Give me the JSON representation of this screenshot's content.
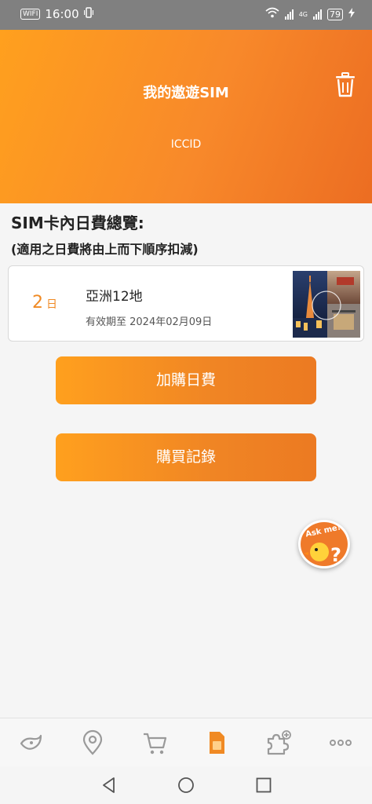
{
  "status_bar": {
    "time": "16:00",
    "left_badge": "WIFI",
    "battery": "79",
    "network": "4G",
    "icons": [
      "wifi-icon",
      "signal-icon",
      "battery-icon",
      "vibrate-icon",
      "charging-icon"
    ]
  },
  "header": {
    "title": "我的遨遊SIM",
    "iccid_label": "ICCID",
    "delete_icon": "trash-icon"
  },
  "overview": {
    "title": "SIM卡內日費總覽:",
    "subtitle": "(適用之日費將由上而下順序扣減)"
  },
  "plan": {
    "days": "2",
    "days_unit": "日",
    "name": "亞洲12地",
    "expiry": "有效期至 2024年02月09日"
  },
  "buttons": {
    "add_daily": "加購日費",
    "purchase_history": "購買記錄"
  },
  "ask_me": {
    "label": "Ask me!"
  },
  "bottom_nav": {
    "items": [
      "bird-logo-icon",
      "location-pin-icon",
      "cart-icon",
      "sim-card-icon",
      "puzzle-plus-icon",
      "more-icon"
    ],
    "active_index": 3,
    "active_color": "#f08a24",
    "inactive_color": "#9a9a9a"
  },
  "colors": {
    "accent": "#f08a24",
    "header_gradient_start": "#ffa01e",
    "header_gradient_end": "#ec6d22"
  }
}
